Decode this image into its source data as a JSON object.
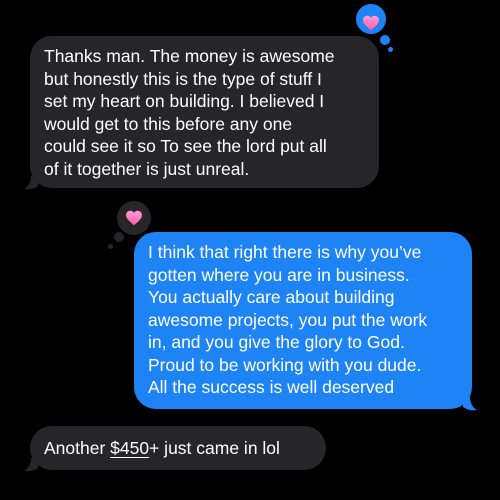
{
  "conversation": {
    "messages": [
      {
        "direction": "incoming",
        "text": "Thanks man. The money is awesome\nbut honestly this is the type of stuff I\nset my heart on building. I believed I\nwould get to this before any one\ncould see it so To see the lord put all\nof it together is just unreal.",
        "reaction": "heart-icon"
      },
      {
        "direction": "outgoing",
        "text": "I think that right there is why you’ve\ngotten where you are in business.\nYou actually care about building\nawesome projects, you put the work\nin, and you give the glory to God.\nProud to be working with you dude.\nAll the success is well deserved",
        "reaction": "heart-icon"
      },
      {
        "direction": "incoming",
        "text_before": "Another ",
        "amount": "$450",
        "text_after": "+ just came in lol"
      }
    ]
  },
  "colors": {
    "background": "#000000",
    "incoming_bubble": "#262628",
    "outgoing_bubble": "#1e84f5",
    "text": "#ffffff",
    "heart_gradient_top": "#ff9ad5",
    "heart_gradient_bottom": "#ff5fa8"
  }
}
